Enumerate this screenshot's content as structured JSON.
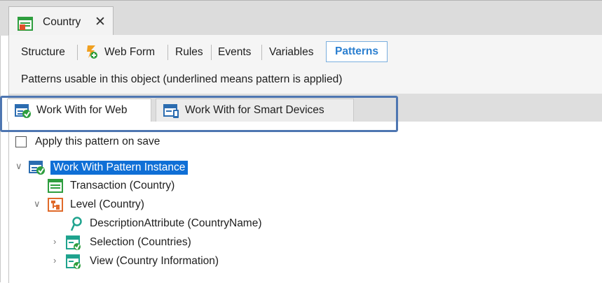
{
  "document_tab": {
    "title": "Country",
    "close": "✕",
    "icon": "transaction-icon"
  },
  "toolbar": {
    "items": [
      "Structure",
      "Web Form",
      "Rules",
      "Events",
      "Variables"
    ],
    "active": "Patterns",
    "web_form_icon": "web-form-icon"
  },
  "info_text": "Patterns usable in this object (underlined means pattern is applied)",
  "pattern_tabs": [
    {
      "label": "Work With for Web",
      "selected": true,
      "icon": "work-with-web-icon"
    },
    {
      "label": "Work With for Smart Devices",
      "selected": false,
      "icon": "work-with-smart-devices-icon"
    }
  ],
  "apply_checkbox": {
    "label": "Apply this pattern on save",
    "checked": false
  },
  "tree": [
    {
      "label": "Work With Pattern Instance",
      "icon": "pattern-instance-icon",
      "expander": "expanded",
      "selected": true
    },
    {
      "label": "Transaction (Country)",
      "icon": "transaction-icon",
      "expander": "none",
      "selected": false
    },
    {
      "label": "Level (Country)",
      "icon": "level-icon",
      "expander": "expanded",
      "selected": false
    },
    {
      "label": "DescriptionAttribute (CountryName)",
      "icon": "description-attribute-icon",
      "expander": "none",
      "selected": false
    },
    {
      "label": "Selection (Countries)",
      "icon": "selection-icon",
      "expander": "collapsed",
      "selected": false
    },
    {
      "label": "View (Country Information)",
      "icon": "view-icon",
      "expander": "collapsed",
      "selected": false
    }
  ],
  "colors": {
    "accent": "#2b7fd0",
    "selection": "#0f6fd6",
    "highlight_border": "#4e76b1",
    "green_icon": "#2e9e3e",
    "orange_icon": "#e06a2a",
    "teal_icon": "#1fa38e"
  }
}
